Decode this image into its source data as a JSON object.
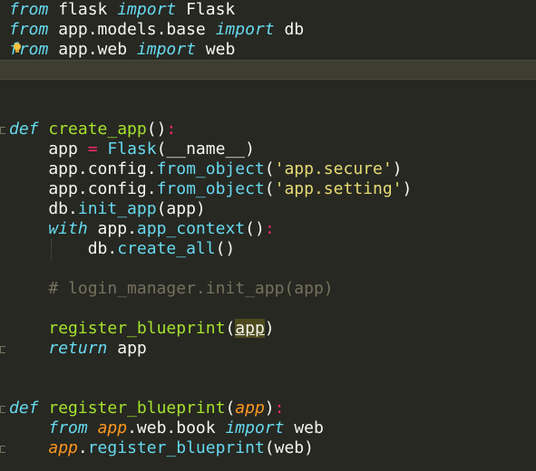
{
  "editor": {
    "lines": {
      "l1": {
        "kw1": "from",
        "mod": " flask ",
        "kw2": "import",
        "name": " Flask"
      },
      "l2": {
        "kw1": "from",
        "mod": " app.models.base ",
        "kw2": "import",
        "name": " db"
      },
      "l3": {
        "kw1": "from",
        "mod": " app.web ",
        "kw2": "import",
        "name": " web"
      },
      "l6": {
        "def": "def",
        "sp": " ",
        "fn": "create_app",
        "paren": "()",
        "colon": ":"
      },
      "l7": {
        "var": "    app ",
        "eq": "=",
        "sp": " ",
        "cls": "Flask",
        "open": "(",
        "arg": "__name__",
        "close": ")"
      },
      "l8": {
        "obj": "    app.config.",
        "meth": "from_object",
        "open": "(",
        "str": "'app.secure'",
        "close": ")"
      },
      "l9": {
        "obj": "    app.config.",
        "meth": "from_object",
        "open": "(",
        "str": "'app.setting'",
        "close": ")"
      },
      "l10": {
        "obj": "    db.",
        "meth": "init_app",
        "args": "(app)"
      },
      "l11": {
        "indent": "    ",
        "kw": "with",
        "obj": " app.",
        "meth": "app_context",
        "paren": "()",
        "colon": ":"
      },
      "l12": {
        "obj": "        db.",
        "meth": "create_all",
        "paren": "()"
      },
      "l14": {
        "comment": "    # login_manager.init_app(app)"
      },
      "l16": {
        "indent": "    ",
        "fn": "register_blueprint",
        "open": "(",
        "arg": "app",
        "close": ")"
      },
      "l17": {
        "indent": "    ",
        "kw": "return",
        "val": " app"
      },
      "l20": {
        "def": "def",
        "sp": " ",
        "fn": "register_blueprint",
        "open": "(",
        "param": "app",
        "close": ")",
        "colon": ":"
      },
      "l21": {
        "indent": "    ",
        "kw1": "from",
        "sp": " ",
        "param": "app",
        "mod": ".web.book ",
        "kw2": "import",
        "name": " web"
      },
      "l22": {
        "indent": "    ",
        "param": "app",
        "obj": ".",
        "meth": "register_blueprint",
        "args": "(web)"
      }
    }
  }
}
